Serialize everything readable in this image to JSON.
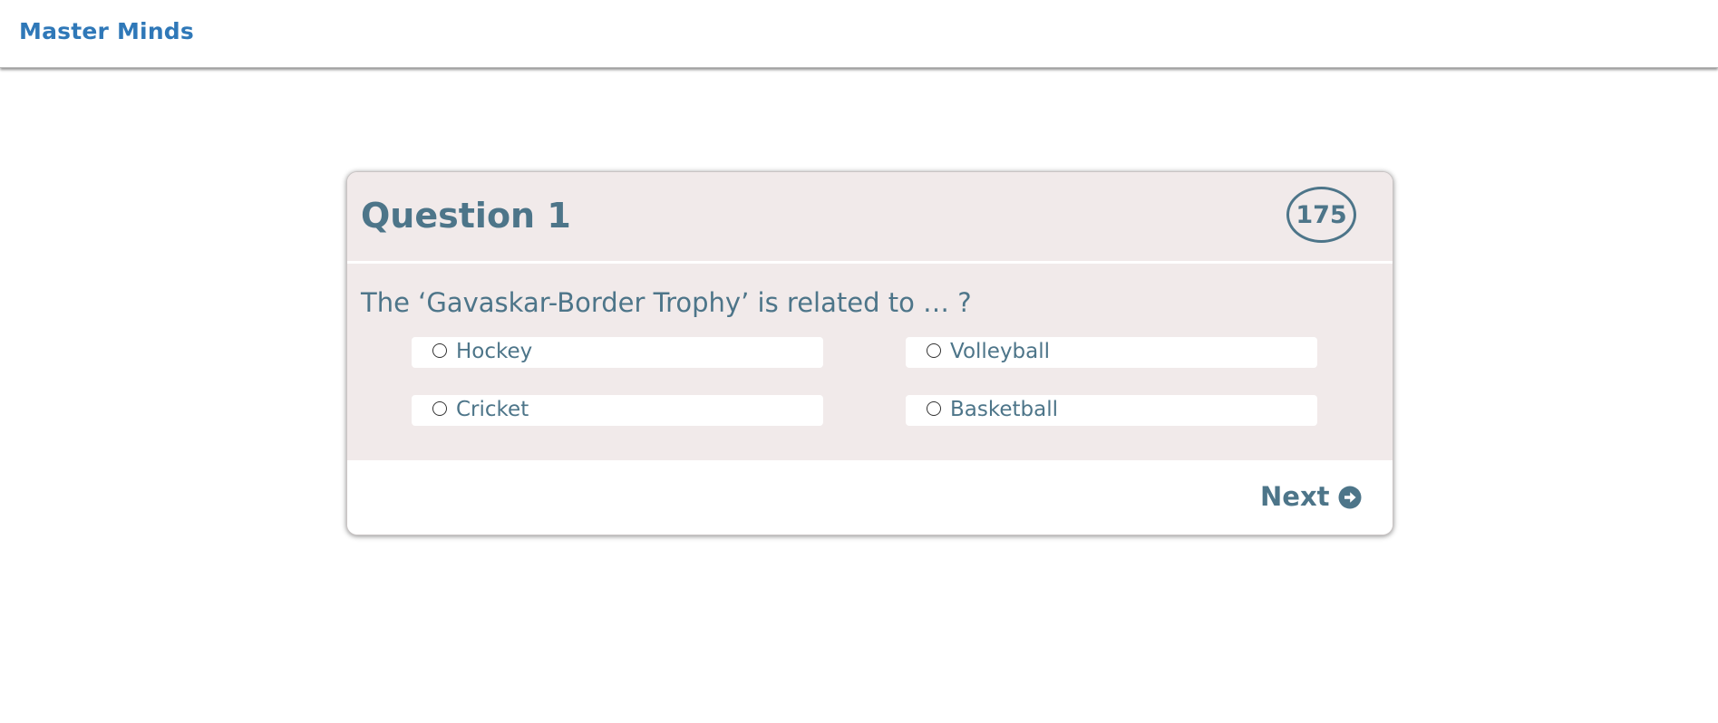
{
  "app": {
    "brand": "Master Minds"
  },
  "quiz": {
    "question_title": "Question 1",
    "timer": "175",
    "question_text": "The ‘Gavaskar-Border Trophy’ is related to … ?",
    "options": [
      {
        "label": "Hockey",
        "selected": false
      },
      {
        "label": "Volleyball",
        "selected": false
      },
      {
        "label": "Cricket",
        "selected": false
      },
      {
        "label": "Basketball",
        "selected": false
      }
    ],
    "next_label": "Next",
    "next_icon": "arrow-circle-right-icon"
  },
  "colors": {
    "brand": "#2f78b8",
    "text": "#4d7589",
    "card_bg": "#f1eaea"
  }
}
